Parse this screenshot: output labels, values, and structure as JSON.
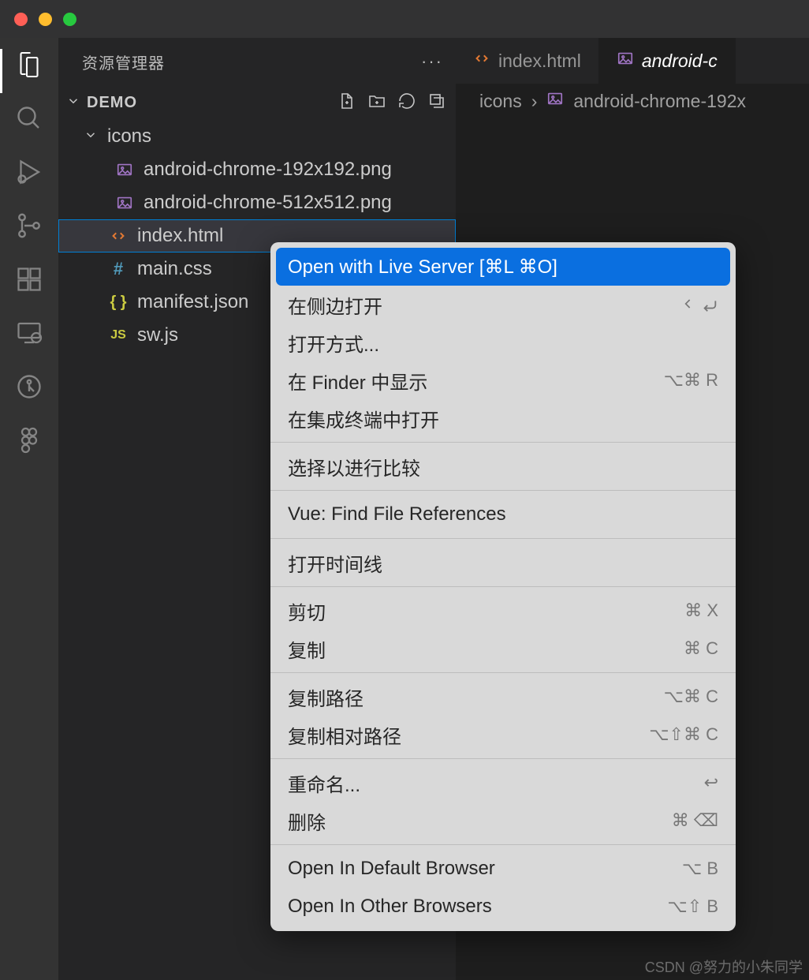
{
  "titlebar": {},
  "activitybar": {
    "items": [
      "explorer",
      "search",
      "run",
      "scm",
      "extensions",
      "remote",
      "git",
      "figma"
    ]
  },
  "sidebar": {
    "title": "资源管理器",
    "project": "DEMO",
    "tree": {
      "folder": "icons",
      "files": [
        {
          "name": "android-chrome-192x192.png",
          "icon": "image"
        },
        {
          "name": "android-chrome-512x512.png",
          "icon": "image"
        }
      ],
      "root_files": [
        {
          "name": "index.html",
          "icon": "html",
          "selected": true
        },
        {
          "name": "main.css",
          "icon": "css"
        },
        {
          "name": "manifest.json",
          "icon": "json"
        },
        {
          "name": "sw.js",
          "icon": "js"
        }
      ]
    }
  },
  "editor": {
    "tabs": [
      {
        "label": "index.html",
        "icon": "html",
        "active": false
      },
      {
        "label": "android-c",
        "icon": "image",
        "active": true
      }
    ],
    "breadcrumb": {
      "folder": "icons",
      "file": "android-chrome-192x",
      "sep": "›"
    }
  },
  "context_menu": {
    "items": [
      {
        "label": "Open with Live Server [⌘L ⌘O]",
        "selected": true
      },
      {
        "label": "在侧边打开",
        "right_icons": true
      },
      {
        "label": "打开方式..."
      },
      {
        "label": "在 Finder 中显示",
        "shortcut": "⌥⌘ R"
      },
      {
        "label": "在集成终端中打开"
      },
      {
        "sep": true
      },
      {
        "label": "选择以进行比较"
      },
      {
        "sep": true
      },
      {
        "label": "Vue: Find File References"
      },
      {
        "sep": true
      },
      {
        "label": "打开时间线"
      },
      {
        "sep": true
      },
      {
        "label": "剪切",
        "shortcut": "⌘ X"
      },
      {
        "label": "复制",
        "shortcut": "⌘ C"
      },
      {
        "sep": true
      },
      {
        "label": "复制路径",
        "shortcut": "⌥⌘ C"
      },
      {
        "label": "复制相对路径",
        "shortcut": "⌥⇧⌘ C"
      },
      {
        "sep": true
      },
      {
        "label": "重命名...",
        "shortcut": "↩"
      },
      {
        "label": "删除",
        "shortcut": "⌘ ⌫"
      },
      {
        "sep": true
      },
      {
        "label": "Open In Default Browser",
        "shortcut": "⌥ B"
      },
      {
        "label": "Open In Other Browsers",
        "shortcut": "⌥⇧ B"
      }
    ]
  },
  "watermark": "CSDN @努力的小朱同学"
}
